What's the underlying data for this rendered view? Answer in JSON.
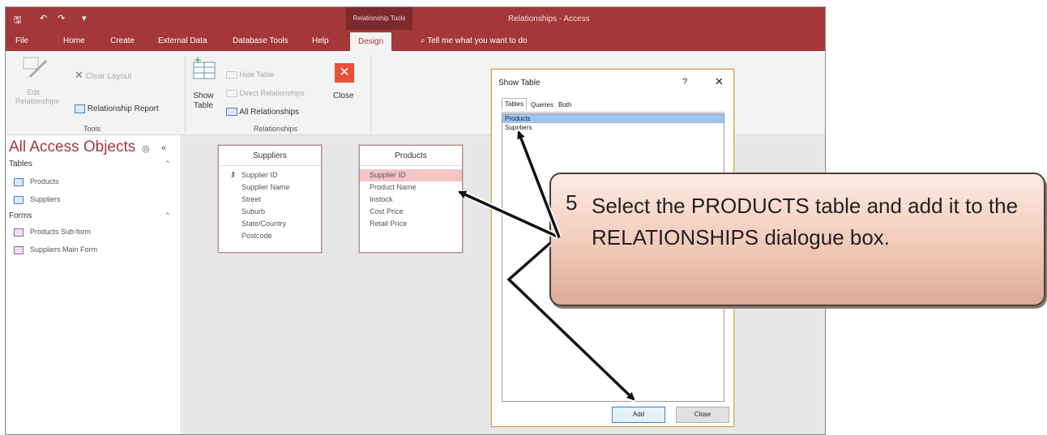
{
  "titlebar": {
    "context_group": "Relationship Tools",
    "window_title": "Relationships - Access"
  },
  "tabs": {
    "file": "File",
    "home": "Home",
    "create": "Create",
    "external": "External Data",
    "dbtools": "Database Tools",
    "help": "Help",
    "design": "Design",
    "tellme": "Tell me what you want to do"
  },
  "ribbon": {
    "edit_relationships": "Edit Relationships",
    "clear_layout": "Clear Layout",
    "relationship_report": "Relationship Report",
    "tools_label": "Tools",
    "show_table": "Show Table",
    "hide_table": "Hide Table",
    "direct_relationships": "Direct Relationships",
    "all_relationships": "All Relationships",
    "close": "Close",
    "relationships_label": "Relationships"
  },
  "nav": {
    "title": "All Access Objects",
    "tables_header": "Tables",
    "tables": [
      "Products",
      "Suppliers"
    ],
    "forms_header": "Forms",
    "forms": [
      "Products Sub-form",
      "Suppliers Main Form"
    ]
  },
  "suppliers_table": {
    "title": "Suppliers",
    "fields": [
      "Supplier ID",
      "Supplier Name",
      "Street",
      "Suburb",
      "State/Country",
      "Postcode"
    ]
  },
  "products_table": {
    "title": "Products",
    "fields": [
      "Supplier ID",
      "Product Name",
      "Instock",
      "Cost Price",
      "Retail Price"
    ]
  },
  "dialog": {
    "title": "Show Table",
    "help": "?",
    "close_glyph": "✕",
    "tabs": [
      "Tables",
      "Queries",
      "Both"
    ],
    "list": [
      "Products",
      "Suppliers"
    ],
    "add_button": "Add",
    "close_button": "Close"
  },
  "callout": {
    "step": "5",
    "text": "Select the PRODUCTS table and add it to the RELATIONSHIPS dialogue box."
  },
  "colors": {
    "accent": "#a4373a",
    "callout_fill": "#f2c9b9",
    "selection": "#9ec4ef"
  }
}
